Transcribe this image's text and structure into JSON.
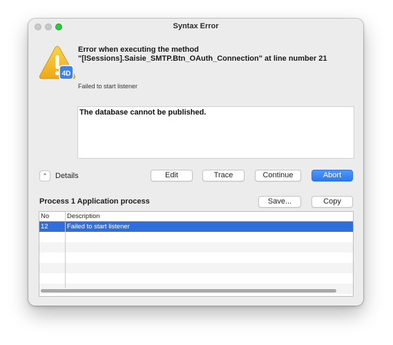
{
  "window": {
    "title": "Syntax Error"
  },
  "icon": {
    "name": "warning-4d-icon",
    "accent": "#f2b21b"
  },
  "error": {
    "line1": "Error when executing the method",
    "line2": "\"[lSessions].Saisie_SMTP.Btn_OAuth_Connection\" at line number 21",
    "subtitle": "Failed to start listener",
    "message": "The database cannot be published."
  },
  "details": {
    "toggle_icon": "chevron-up-icon",
    "label": "Details"
  },
  "actions": {
    "edit": "Edit",
    "trace": "Trace",
    "continue": "Continue",
    "abort": "Abort",
    "primary_color": "#2f7bf0"
  },
  "process": {
    "label": "Process 1 Application process",
    "save": "Save...",
    "copy": "Copy"
  },
  "table": {
    "columns": [
      "No",
      "Description"
    ],
    "rows": [
      {
        "no": "12",
        "description": "Failed to start listener",
        "selected": true
      }
    ],
    "selection_color": "#2f6edc"
  }
}
